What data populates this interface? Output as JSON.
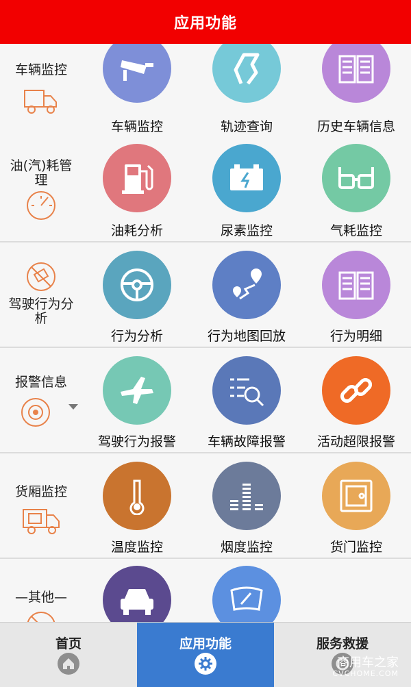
{
  "header": {
    "title": "应用功能"
  },
  "colors": {
    "header": "#f20000",
    "active_tab": "#3a7bd0"
  },
  "sections": [
    {
      "category": "车辆监控",
      "category_icon": "truck-icon",
      "items": [
        {
          "label": "车辆监控",
          "icon": "cctv-camera-icon",
          "color": "#7e8fd8"
        },
        {
          "label": "轨迹查询",
          "icon": "track-route-icon",
          "color": "#76c9d8"
        },
        {
          "label": "历史车辆信息",
          "icon": "open-book-icon",
          "color": "#b987d9"
        }
      ]
    },
    {
      "category": "油(汽)耗管理",
      "category_icon": "gauge-icon",
      "items": [
        {
          "label": "油耗分析",
          "icon": "fuel-pump-icon",
          "color": "#e0777d"
        },
        {
          "label": "尿素监控",
          "icon": "battery-icon",
          "color": "#4aa7cf"
        },
        {
          "label": "气耗监控",
          "icon": "glasses-icon",
          "color": "#74c9a4"
        }
      ]
    },
    {
      "category": "驾驶行为分析",
      "category_icon": "no-phone-icon",
      "items": [
        {
          "label": "行为分析",
          "icon": "steering-wheel-icon",
          "color": "#5aa5be"
        },
        {
          "label": "行为地图回放",
          "icon": "map-pin-route-icon",
          "color": "#5e7fc5"
        },
        {
          "label": "行为明细",
          "icon": "open-book-icon",
          "color": "#b987d9"
        }
      ]
    },
    {
      "category": "报警信息",
      "category_icon": "alarm-target-icon",
      "items": [
        {
          "label": "驾驶行为报警",
          "icon": "airplane-icon",
          "color": "#76c8b4"
        },
        {
          "label": "车辆故障报警",
          "icon": "list-search-icon",
          "color": "#5a78b8"
        },
        {
          "label": "活动超限报警",
          "icon": "chain-link-icon",
          "color": "#ef6a26"
        }
      ]
    },
    {
      "category": "货厢监控",
      "category_icon": "cargo-truck-icon",
      "items": [
        {
          "label": "温度监控",
          "icon": "thermometer-icon",
          "color": "#c9742f"
        },
        {
          "label": "烟度监控",
          "icon": "equalizer-icon",
          "color": "#6c7b9a"
        },
        {
          "label": "货门监控",
          "icon": "safe-door-icon",
          "color": "#e8a857"
        }
      ]
    },
    {
      "category": "—其他—",
      "category_icon": "no-phone-icon",
      "items": [
        {
          "label": "",
          "icon": "car-icon",
          "color": "#5b4a8f"
        },
        {
          "label": "",
          "icon": "windshield-icon",
          "color": "#5c90e0"
        }
      ]
    }
  ],
  "nav": [
    {
      "label": "首页",
      "icon": "home-icon",
      "active": false
    },
    {
      "label": "应用功能",
      "icon": "gear-icon",
      "active": true
    },
    {
      "label": "服务救援",
      "icon": "rescue-icon",
      "active": false
    }
  ],
  "watermark": {
    "line1": "商用车之家",
    "line2": "CVCHOME.COM"
  }
}
